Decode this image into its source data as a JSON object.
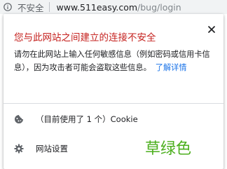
{
  "address_bar": {
    "security_label": "不安全",
    "url_host": "www.511easy.com",
    "url_path": "/bug/login",
    "info_icon": "info-circle-icon"
  },
  "popup": {
    "title": "您与此网站之间建立的连接不安全",
    "close_icon": "close-icon",
    "description": "请勿在此网站上输入任何敏感信息（例如密码或信用卡信息），因为攻击者可能会盗取这些信息。",
    "learn_more": "了解详情",
    "cookies_label": "（目前使用了 1 个）Cookie",
    "cookies_icon": "cookie-icon",
    "site_settings_label": "网站设置",
    "site_settings_icon": "gear-icon"
  },
  "annotation": {
    "text": "草绿色"
  },
  "colors": {
    "title_red": "#c5221f",
    "link_blue": "#1a73e8",
    "annotation_green": "#4caf1e"
  }
}
